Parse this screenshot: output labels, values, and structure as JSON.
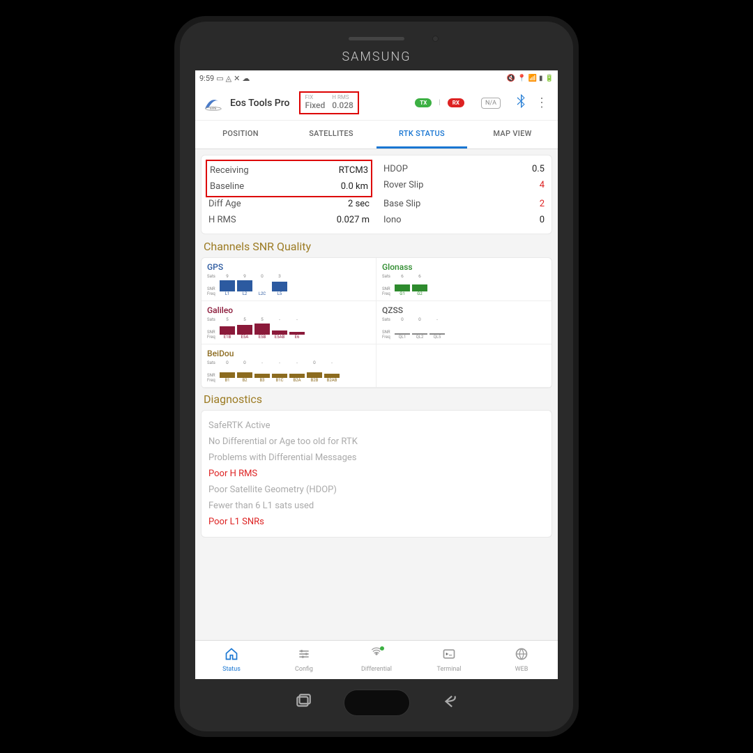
{
  "device_brand": "SAMSUNG",
  "statusbar": {
    "time": "9:59"
  },
  "header": {
    "app_title": "Eos Tools Pro",
    "fix_label": "FIX",
    "fix_value": "Fixed",
    "hrms_label": "H RMS",
    "hrms_value": "0.028",
    "tx": "TX",
    "rx": "RX",
    "na": "N/A"
  },
  "tabs": [
    "POSITION",
    "SATELLITES",
    "RTK STATUS",
    "MAP VIEW"
  ],
  "active_tab": 2,
  "rtk": {
    "receiving_k": "Receiving",
    "receiving_v": "RTCM3",
    "baseline_k": "Baseline",
    "baseline_v": "0.0 km",
    "diffage_k": "Diff Age",
    "diffage_v": "2 sec",
    "hrms_k": "H RMS",
    "hrms_v": "0.027 m",
    "hdop_k": "HDOP",
    "hdop_v": "0.5",
    "roverslip_k": "Rover Slip",
    "roverslip_v": "4",
    "baseslip_k": "Base Slip",
    "baseslip_v": "2",
    "iono_k": "Iono",
    "iono_v": "0"
  },
  "snr_title": "Channels SNR Quality",
  "snr": {
    "row_sats": "Sats",
    "row_snr": "SNR",
    "row_freq": "Freq",
    "gps": {
      "title": "GPS",
      "color": "#2c5aa0",
      "sats": [
        "9",
        "9",
        "0",
        "3"
      ],
      "freqs": [
        "L1",
        "L2",
        "L2C",
        "L5"
      ],
      "snr_h": [
        16,
        16,
        0,
        14
      ]
    },
    "glonass": {
      "title": "Glonass",
      "color": "#2e8b2e",
      "sats": [
        "6",
        "6"
      ],
      "freqs": [
        "G1",
        "G2"
      ],
      "snr_h": [
        10,
        10
      ]
    },
    "galileo": {
      "title": "Galileo",
      "color": "#8b1a3a",
      "sats": [
        "5",
        "5",
        "5",
        "-",
        "-"
      ],
      "freqs": [
        "E1B",
        "E5A",
        "E5B",
        "E5AB",
        "E6"
      ],
      "snr_h": [
        12,
        14,
        16,
        6,
        4
      ]
    },
    "qzss": {
      "title": "QZSS",
      "color": "#888888",
      "sats": [
        "0",
        "0",
        "-"
      ],
      "freqs": [
        "QL1",
        "QL2",
        "QL5"
      ],
      "snr_h": [
        2,
        2,
        2
      ]
    },
    "beidou": {
      "title": "BeiDou",
      "color": "#8c6b1f",
      "sats": [
        "0",
        "0",
        "-",
        "-",
        "-",
        "0",
        "-"
      ],
      "freqs": [
        "B1",
        "B2",
        "B3",
        "B1C",
        "B2A",
        "B2B",
        "B2AB"
      ],
      "snr_h": [
        8,
        8,
        6,
        6,
        6,
        8,
        6
      ]
    }
  },
  "diag_title": "Diagnostics",
  "diagnostics": [
    {
      "text": "SafeRTK Active",
      "red": false
    },
    {
      "text": "No Differential or Age too old for RTK",
      "red": false
    },
    {
      "text": "Problems with Differential Messages",
      "red": false
    },
    {
      "text": "Poor H RMS",
      "red": true
    },
    {
      "text": "Poor Satellite Geometry (HDOP)",
      "red": false
    },
    {
      "text": "Fewer than 6 L1 sats used",
      "red": false
    },
    {
      "text": "Poor L1 SNRs",
      "red": true
    }
  ],
  "bottom_nav": [
    {
      "label": "Status",
      "icon": "home",
      "active": true
    },
    {
      "label": "Config",
      "icon": "sliders",
      "active": false
    },
    {
      "label": "Differential",
      "icon": "antenna",
      "active": false,
      "dot": true
    },
    {
      "label": "Terminal",
      "icon": "terminal",
      "active": false
    },
    {
      "label": "WEB",
      "icon": "globe",
      "active": false
    }
  ],
  "chart_data": [
    {
      "type": "bar",
      "title": "GPS SNR",
      "categories": [
        "L1",
        "L2",
        "L2C",
        "L5"
      ],
      "series": [
        {
          "name": "Sats",
          "values": [
            9,
            9,
            0,
            3
          ]
        }
      ]
    },
    {
      "type": "bar",
      "title": "Glonass SNR",
      "categories": [
        "G1",
        "G2"
      ],
      "series": [
        {
          "name": "Sats",
          "values": [
            6,
            6
          ]
        }
      ]
    },
    {
      "type": "bar",
      "title": "Galileo SNR",
      "categories": [
        "E1B",
        "E5A",
        "E5B",
        "E5AB",
        "E6"
      ],
      "series": [
        {
          "name": "Sats",
          "values": [
            5,
            5,
            5,
            0,
            0
          ]
        }
      ]
    },
    {
      "type": "bar",
      "title": "QZSS SNR",
      "categories": [
        "QL1",
        "QL2",
        "QL5"
      ],
      "series": [
        {
          "name": "Sats",
          "values": [
            0,
            0,
            0
          ]
        }
      ]
    },
    {
      "type": "bar",
      "title": "BeiDou SNR",
      "categories": [
        "B1",
        "B2",
        "B3",
        "B1C",
        "B2A",
        "B2B",
        "B2AB"
      ],
      "series": [
        {
          "name": "Sats",
          "values": [
            0,
            0,
            0,
            0,
            0,
            0,
            0
          ]
        }
      ]
    }
  ]
}
